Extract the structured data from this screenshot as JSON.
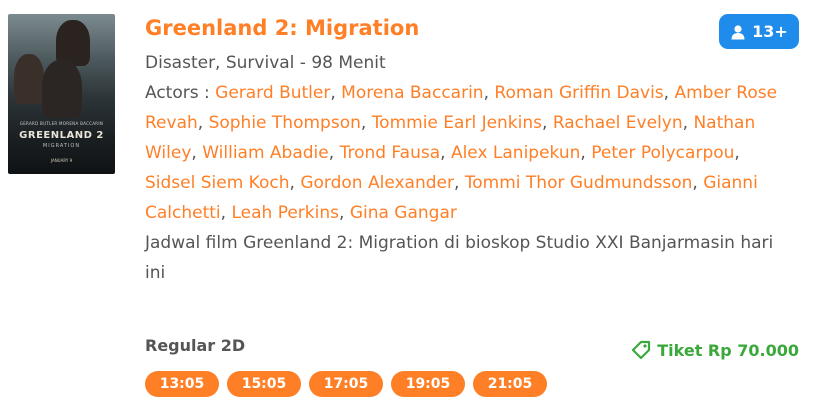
{
  "movie": {
    "title": "Greenland 2: Migration",
    "genre_duration": "Disaster, Survival - 98 Menit",
    "actors_label": "Actors :",
    "actors": [
      "Gerard Butler",
      "Morena Baccarin",
      "Roman Griffin Davis",
      "Amber Rose Revah",
      "Sophie Thompson",
      "Tommie Earl Jenkins",
      "Rachael Evelyn",
      "Nathan Wiley",
      "William Abadie",
      "Trond Fausa",
      "Alex Lanipekun",
      "Peter Polycarpou",
      "Sidsel Siem Koch",
      "Gordon Alexander",
      "Tommi Thor Gudmundsson",
      "Gianni Calchetti",
      "Leah Perkins",
      "Gina Gangar"
    ],
    "schedule_text": "Jadwal film Greenland 2: Migration di bioskop Studio XXI Banjarmasin hari ini",
    "age_rating": "13+",
    "poster": {
      "title_main": "GREENLAND 2",
      "title_sub": "MIGRATION",
      "names": "GERARD BUTLER   MORENA BACCARIN",
      "date": "JANUARY 9"
    }
  },
  "showing": {
    "format": "Regular 2D",
    "price": "Tiket Rp 70.000",
    "times": [
      "13:05",
      "15:05",
      "17:05",
      "19:05",
      "21:05"
    ]
  },
  "colors": {
    "accent": "#ff7f27",
    "badge": "#1f8ceb",
    "price": "#3aa83a",
    "text": "#555555"
  }
}
